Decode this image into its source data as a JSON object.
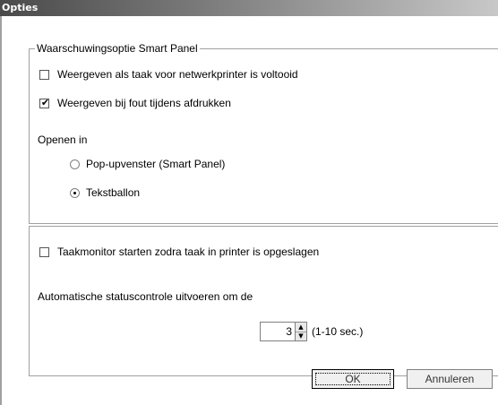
{
  "window": {
    "title": "Opties"
  },
  "group1": {
    "legend": "Waarschuwingsoptie Smart Panel",
    "check_network": {
      "label": "Weergeven als taak voor netwerkprinter is voltooid",
      "checked": false
    },
    "check_error": {
      "label": "Weergeven bij fout tijdens afdrukken",
      "checked": true
    },
    "open_in_label": "Openen in",
    "radio_popup": {
      "label": "Pop-upvenster (Smart Panel)",
      "selected": false
    },
    "radio_balloon": {
      "label": "Tekstballon",
      "selected": true
    }
  },
  "group2": {
    "check_monitor": {
      "label": "Taakmonitor starten zodra taak in printer is opgeslagen",
      "checked": false
    },
    "status_label": "Automatische statuscontrole uitvoeren om de",
    "spin_value": "3",
    "spin_range": "(1-10 sec.)",
    "spin_up_glyph": "▲",
    "spin_down_glyph": "▼"
  },
  "buttons": {
    "ok": "OK",
    "cancel": "Annuleren"
  },
  "glyphs": {
    "check": "✔"
  }
}
